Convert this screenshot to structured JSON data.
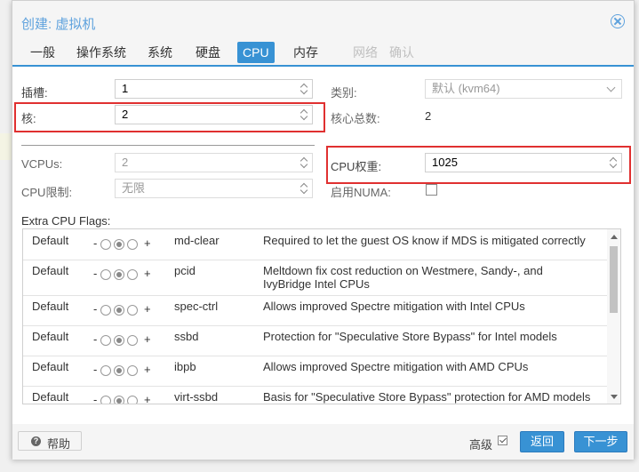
{
  "dialog": {
    "title": "创建: 虚拟机",
    "close_icon": "close-circle-icon"
  },
  "tabs": [
    {
      "label": "一般",
      "state": "normal"
    },
    {
      "label": "操作系统",
      "state": "normal"
    },
    {
      "label": "系统",
      "state": "normal"
    },
    {
      "label": "硬盘",
      "state": "normal"
    },
    {
      "label": "CPU",
      "state": "active"
    },
    {
      "label": "内存",
      "state": "normal"
    },
    {
      "label": "网络",
      "state": "disabled"
    },
    {
      "label": "确认",
      "state": "disabled"
    }
  ],
  "form": {
    "sockets_label": "插槽:",
    "sockets_value": "1",
    "cores_label": "核:",
    "cores_value": "2",
    "type_label": "类别:",
    "type_value": "默认 (kvm64)",
    "total_cores_label": "核心总数:",
    "total_cores_value": "2",
    "vcpus_label": "VCPUs:",
    "vcpus_value": "2",
    "cpulimit_label": "CPU限制:",
    "cpulimit_value": "无限",
    "cpuunits_label": "CPU权重:",
    "cpuunits_value": "1025",
    "numa_label": "启用NUMA:",
    "numa_checked": false
  },
  "flags": {
    "title": "Extra CPU Flags:",
    "rows": [
      {
        "state": "Default",
        "name": "md-clear",
        "desc": "Required to let the guest OS know if MDS is mitigated correctly"
      },
      {
        "state": "Default",
        "name": "pcid",
        "desc": "Meltdown fix cost reduction on Westmere, Sandy-, and IvyBridge Intel CPUs"
      },
      {
        "state": "Default",
        "name": "spec-ctrl",
        "desc": "Allows improved Spectre mitigation with Intel CPUs"
      },
      {
        "state": "Default",
        "name": "ssbd",
        "desc": "Protection for \"Speculative Store Bypass\" for Intel models"
      },
      {
        "state": "Default",
        "name": "ibpb",
        "desc": "Allows improved Spectre mitigation with AMD CPUs"
      },
      {
        "state": "Default",
        "name": "virt-ssbd",
        "desc": "Basis for \"Speculative Store Bypass\" protection for AMD models"
      }
    ],
    "minus": "-",
    "plus": "+"
  },
  "footer": {
    "help_label": "帮助",
    "advanced_label": "高级",
    "advanced_checked": true,
    "back_label": "返回",
    "next_label": "下一步"
  },
  "colors": {
    "accent": "#3892d4",
    "title": "#5fa2dd",
    "highlight": "#e03030"
  }
}
